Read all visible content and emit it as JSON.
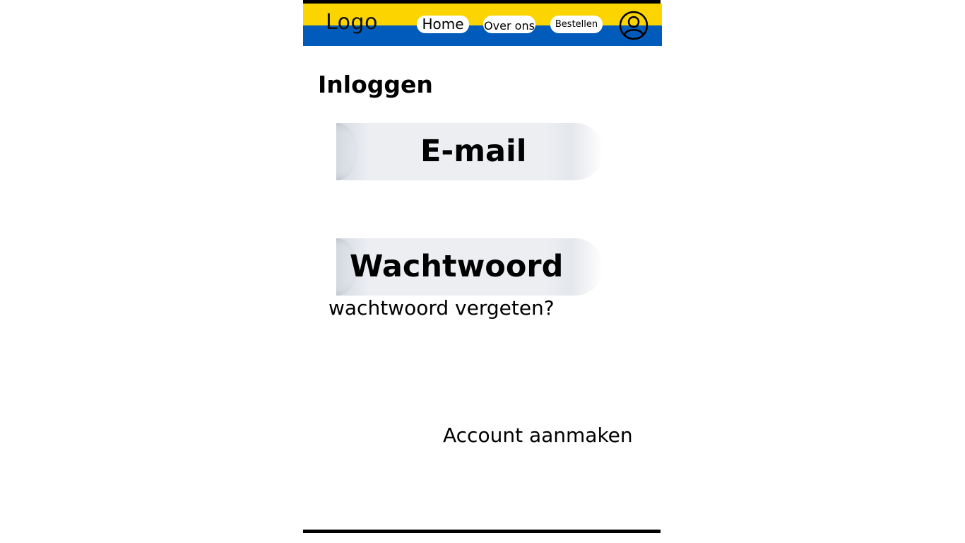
{
  "header": {
    "logo": "Logo",
    "colors": {
      "top_stripe": "#fcd400",
      "bottom_stripe": "#005bbb"
    },
    "nav": {
      "home": "Home",
      "about": "Over ons",
      "order": "Bestellen"
    },
    "account_icon": "user-circle-icon"
  },
  "login": {
    "title": "Inloggen",
    "email_label": "E-mail",
    "password_label": "Wachtwoord",
    "forgot_password": "wachtwoord vergeten?",
    "create_account": "Account aanmaken"
  }
}
